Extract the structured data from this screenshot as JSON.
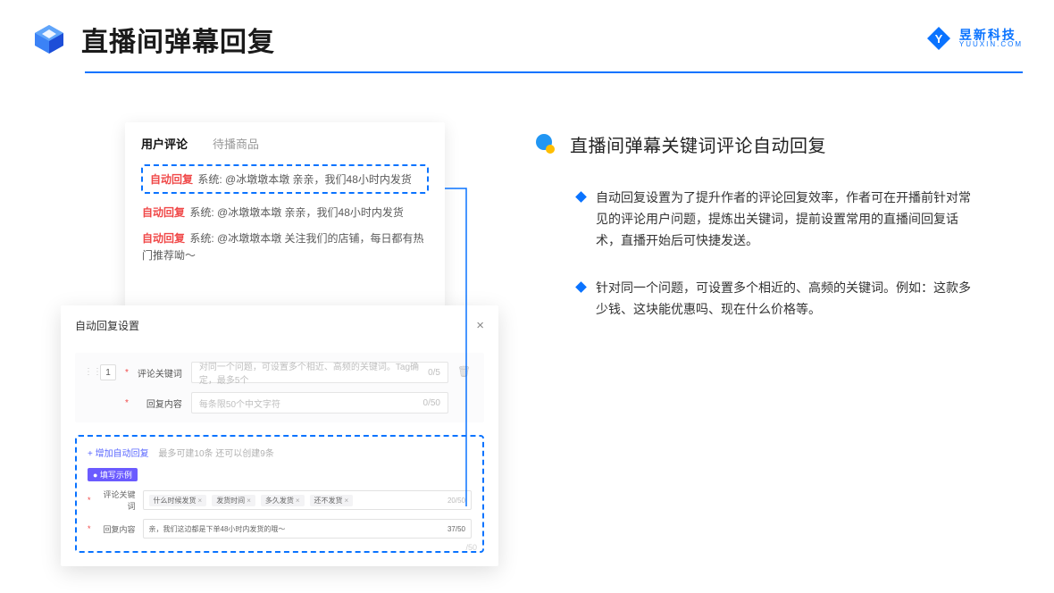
{
  "header": {
    "title": "直播间弹幕回复",
    "logo_cn": "昱新科技",
    "logo_en": "YUUXIN.COM"
  },
  "comments_card": {
    "tab_active": "用户评论",
    "tab_inactive": "待播商品",
    "auto_badge": "自动回复",
    "highlight_text": "系统: @冰墩墩本墩 亲亲，我们48小时内发货",
    "row2": "系统: @冰墩墩本墩 亲亲，我们48小时内发货",
    "row3": "系统: @冰墩墩本墩 关注我们的店铺，每日都有热门推荐呦～"
  },
  "settings_card": {
    "title": "自动回复设置",
    "num": "1",
    "label_keyword": "评论关键词",
    "placeholder_keyword": "对同一个问题，可设置多个相近、高频的关键词。Tag确定，最多5个",
    "count_keyword": "0/5",
    "label_content": "回复内容",
    "placeholder_content": "每条限50个中文字符",
    "count_content": "0/50",
    "add_label": "+ 增加自动回复",
    "add_hint": "最多可建10条 还可以创建9条",
    "example_badge": "● 填写示例",
    "ex_label_keyword": "评论关键词",
    "ex_tags": [
      "什么时候发货",
      "发货时间",
      "多久发货",
      "还不发货"
    ],
    "ex_tag_count": "20/50",
    "ex_label_content": "回复内容",
    "ex_content": "亲，我们这边都是下单48小时内发货的哦～",
    "ex_content_count": "37/50",
    "ghost_counter": "/50"
  },
  "right": {
    "section_title": "直播间弹幕关键词评论自动回复",
    "bullet1": "自动回复设置为了提升作者的评论回复效率，作者可在开播前针对常见的评论用户问题，提炼出关键词，提前设置常用的直播间回复话术，直播开始后可快捷发送。",
    "bullet2": "针对同一个问题，可设置多个相近的、高频的关键词。例如：这款多少钱、这块能优惠吗、现在什么价格等。"
  }
}
